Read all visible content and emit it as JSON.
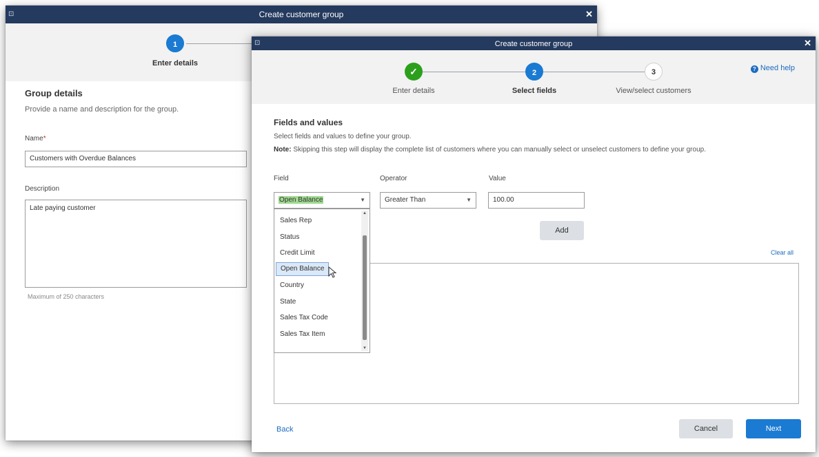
{
  "back_dialog": {
    "title": "Create customer group",
    "window_icon": "⊡",
    "close_glyph": "✕",
    "steps": [
      {
        "number": "1",
        "label": "Enter details"
      }
    ],
    "section_title": "Group details",
    "section_help": "Provide a name and description for the group.",
    "name_label": "Name",
    "required_marker": "*",
    "name_value": "Customers with Overdue Balances",
    "description_label": "Description",
    "description_value": "Late paying customer",
    "description_hint": "Maximum of 250 characters"
  },
  "front_dialog": {
    "title": "Create customer group",
    "window_icon": "⊡",
    "close_glyph": "✕",
    "need_help": "Need help",
    "help_icon_glyph": "?",
    "steps": [
      {
        "number": "✓",
        "label": "Enter details",
        "state": "complete"
      },
      {
        "number": "2",
        "label": "Select fields",
        "state": "active"
      },
      {
        "number": "3",
        "label": "View/select customers",
        "state": "pending"
      }
    ],
    "section_title": "Fields and values",
    "section_help": "Select fields and values to define your group.",
    "note_label": "Note:",
    "note_text": "Skipping this step will display the complete list of customers where you can manually select or unselect customers to define your group.",
    "field_header": "Field",
    "operator_header": "Operator",
    "value_header": "Value",
    "field_selected": "Open Balance",
    "operator_selected": "Greater Than",
    "value_input": "100.00",
    "add_label": "Add",
    "clear_all_label": "Clear all",
    "dropdown_options": [
      "Sales Rep",
      "Status",
      "Credit Limit",
      "Open Balance",
      "Country",
      "State",
      "Sales Tax Code",
      "Sales Tax Item"
    ],
    "dropdown_highlighted": "Open Balance",
    "back_label": "Back",
    "cancel_label": "Cancel",
    "next_label": "Next"
  },
  "colors": {
    "titlebar": "#243a5e",
    "accent_blue": "#1b7ad2",
    "complete_green": "#2ca01c",
    "highlight_green": "#9fd88f"
  }
}
